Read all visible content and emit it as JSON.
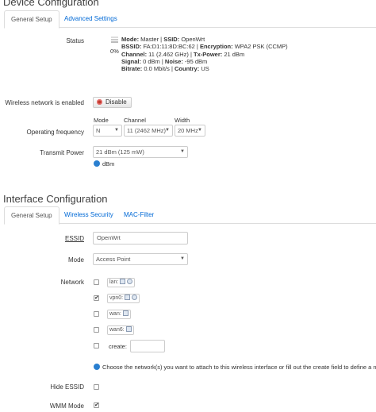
{
  "device": {
    "title": "Device Configuration",
    "tabs": [
      {
        "label": "General Setup"
      },
      {
        "label": "Advanced Settings"
      }
    ],
    "status": {
      "label": "Status",
      "percent": "0%",
      "lines": [
        {
          "k1": "Mode:",
          "v1": " Master | ",
          "k2": "SSID:",
          "v2": " OpenWrt"
        },
        {
          "k1": "BSSID:",
          "v1": " FA:D1:11:8D:BC:62 | ",
          "k2": "Encryption:",
          "v2": " WPA2 PSK (CCMP)"
        },
        {
          "k1": "Channel:",
          "v1": " 11 (2.462 GHz) | ",
          "k2": "Tx-Power:",
          "v2": " 21 dBm"
        },
        {
          "k1": "Signal:",
          "v1": " 0 dBm | ",
          "k2": "Noise:",
          "v2": " -95 dBm"
        },
        {
          "k1": "Bitrate:",
          "v1": " 0.0 Mbit/s | ",
          "k2": "Country:",
          "v2": " US"
        }
      ]
    },
    "wireless_enabled": {
      "label": "Wireless network is enabled",
      "button": "Disable"
    },
    "frequency": {
      "label": "Operating frequency",
      "mode": {
        "caption": "Mode",
        "value": "N"
      },
      "channel": {
        "caption": "Channel",
        "value": "11 (2462 MHz)"
      },
      "width": {
        "caption": "Width",
        "value": "20 MHz"
      }
    },
    "tx_power": {
      "label": "Transmit Power",
      "value": "21 dBm (125 mW)",
      "hint": "dBm"
    }
  },
  "interface": {
    "title": "Interface Configuration",
    "tabs": [
      {
        "label": "General Setup"
      },
      {
        "label": "Wireless Security"
      },
      {
        "label": "MAC-Filter"
      }
    ],
    "essid": {
      "label": "ESSID",
      "value": "OpenWrt"
    },
    "mode": {
      "label": "Mode",
      "value": "Access Point"
    },
    "network": {
      "label": "Network",
      "items": [
        {
          "name": "lan:",
          "checked": false
        },
        {
          "name": "vpn0:",
          "checked": true
        },
        {
          "name": "wan:",
          "checked": false
        },
        {
          "name": "wan6:",
          "checked": false
        }
      ],
      "create_label": "create:",
      "create_value": "",
      "hint": "Choose the network(s) you want to attach to this wireless interface or fill out the create field to define a ne"
    },
    "hide_essid": {
      "label": "Hide ESSID",
      "checked": false
    },
    "wmm_mode": {
      "label": "WMM Mode",
      "checked": true
    }
  },
  "icons": {
    "checked_mark": "✔",
    "dropdown": "▼"
  }
}
